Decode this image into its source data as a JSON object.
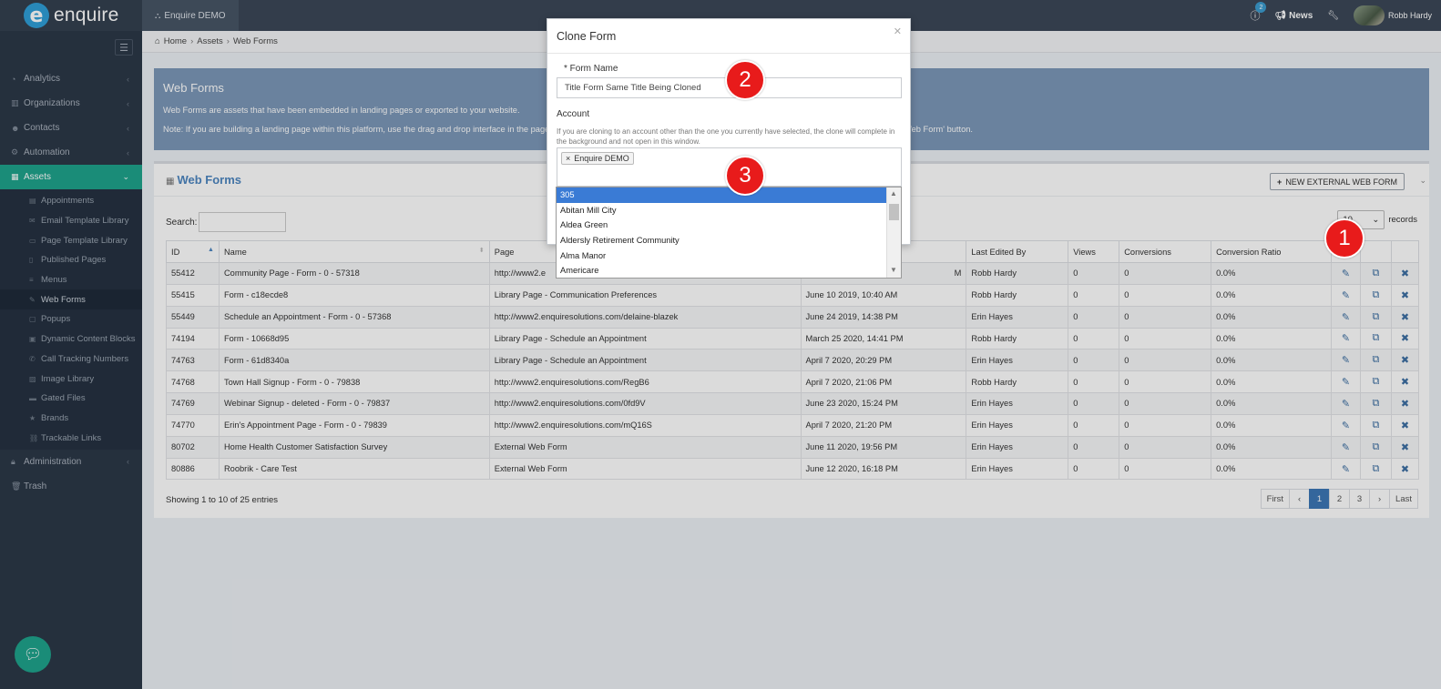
{
  "app": {
    "logo_letter": "e",
    "logo_text": "enquire",
    "tenant_tab": "Enquire DEMO"
  },
  "topbar": {
    "notifications_count": "2",
    "news_label": "News",
    "user_name": "Robb Hardy"
  },
  "sidebar": {
    "items": [
      {
        "label": "Analytics",
        "icon": "chart-icon"
      },
      {
        "label": "Organizations",
        "icon": "building-icon"
      },
      {
        "label": "Contacts",
        "icon": "users-icon"
      },
      {
        "label": "Automation",
        "icon": "gears-icon"
      },
      {
        "label": "Assets",
        "icon": "grid-icon"
      }
    ],
    "sub_items": [
      "Appointments",
      "Email Template Library",
      "Page Template Library",
      "Published Pages",
      "Menus",
      "Web Forms",
      "Popups",
      "Dynamic Content Blocks",
      "Call Tracking Numbers",
      "Image Library",
      "Gated Files",
      "Brands",
      "Trackable Links"
    ],
    "admin_label": "Administration",
    "trash_label": "Trash"
  },
  "breadcrumb": {
    "home": "Home",
    "assets": "Assets",
    "current": "Web Forms"
  },
  "info": {
    "title": "Web Forms",
    "line1": "Web Forms are assets that have been embedded in landing pages or exported to your website.",
    "line2_left": "Note: If you are building a landing page within this platform, use the drag and drop interface in the page",
    "line2_right": "Web Form' button."
  },
  "panel": {
    "title": "Web Forms",
    "new_button": "NEW EXTERNAL WEB FORM",
    "search_label": "Search:",
    "records_value": "10",
    "records_label": "records"
  },
  "table": {
    "headers": [
      "ID",
      "Name",
      "Page",
      "",
      "Last Edited By",
      "Views",
      "Conversions",
      "Conversion Ratio"
    ],
    "rows": [
      [
        "55412",
        "Community Page - Form - 0 - 57318",
        "http://www2.e",
        "M",
        "Robb Hardy",
        "0",
        "0",
        "0.0%"
      ],
      [
        "55415",
        "Form - c18ecde8",
        "Library Page - Communication Preferences",
        "June 10 2019, 10:40 AM",
        "Robb Hardy",
        "0",
        "0",
        "0.0%"
      ],
      [
        "55449",
        "Schedule an Appointment - Form - 0 - 57368",
        "http://www2.enquiresolutions.com/delaine-blazek",
        "June 24 2019, 14:38 PM",
        "Erin Hayes",
        "0",
        "0",
        "0.0%"
      ],
      [
        "74194",
        "Form - 10668d95",
        "Library Page - Schedule an Appointment",
        "March 25 2020, 14:41 PM",
        "Robb Hardy",
        "0",
        "0",
        "0.0%"
      ],
      [
        "74763",
        "Form - 61d8340a",
        "Library Page - Schedule an Appointment",
        "April 7 2020, 20:29 PM",
        "Erin Hayes",
        "0",
        "0",
        "0.0%"
      ],
      [
        "74768",
        "Town Hall Signup - Form - 0 - 79838",
        "http://www2.enquiresolutions.com/RegB6",
        "April 7 2020, 21:06 PM",
        "Robb Hardy",
        "0",
        "0",
        "0.0%"
      ],
      [
        "74769",
        "Webinar Signup - deleted - Form - 0 - 79837",
        "http://www2.enquiresolutions.com/0fd9V",
        "June 23 2020, 15:24 PM",
        "Erin Hayes",
        "0",
        "0",
        "0.0%"
      ],
      [
        "74770",
        "Erin's Appointment Page - Form - 0 - 79839",
        "http://www2.enquiresolutions.com/mQ16S",
        "April 7 2020, 21:20 PM",
        "Erin Hayes",
        "0",
        "0",
        "0.0%"
      ],
      [
        "80702",
        "Home Health Customer Satisfaction Survey",
        "External Web Form",
        "June 11 2020, 19:56 PM",
        "Erin Hayes",
        "0",
        "0",
        "0.0%"
      ],
      [
        "80886",
        "Roobrik - Care Test",
        "External Web Form",
        "June 12 2020, 16:18 PM",
        "Erin Hayes",
        "0",
        "0",
        "0.0%"
      ]
    ],
    "footer": "Showing 1 to 10 of 25 entries",
    "pager": [
      "First",
      "‹",
      "1",
      "2",
      "3",
      "›",
      "Last"
    ]
  },
  "modal": {
    "title": "Clone Form",
    "form_name_label": "* Form Name",
    "form_name_value": "Title Form Same Title Being Cloned",
    "account_label": "Account",
    "account_help": "If you are cloning to an account other than the one you currently have selected, the clone will complete in the background and not open in this window.",
    "selected_tag": "Enquire DEMO",
    "options": [
      "305",
      "Abitan Mill City",
      "Aldea Green",
      "Aldersly Retirement Community",
      "Alma Manor",
      "Americare"
    ]
  },
  "callouts": [
    "1",
    "2",
    "3"
  ],
  "colors": {
    "accent": "#1fa38c",
    "link": "#4d86c0",
    "callout": "#e81b1b",
    "info_bg": "#7c98b8"
  }
}
